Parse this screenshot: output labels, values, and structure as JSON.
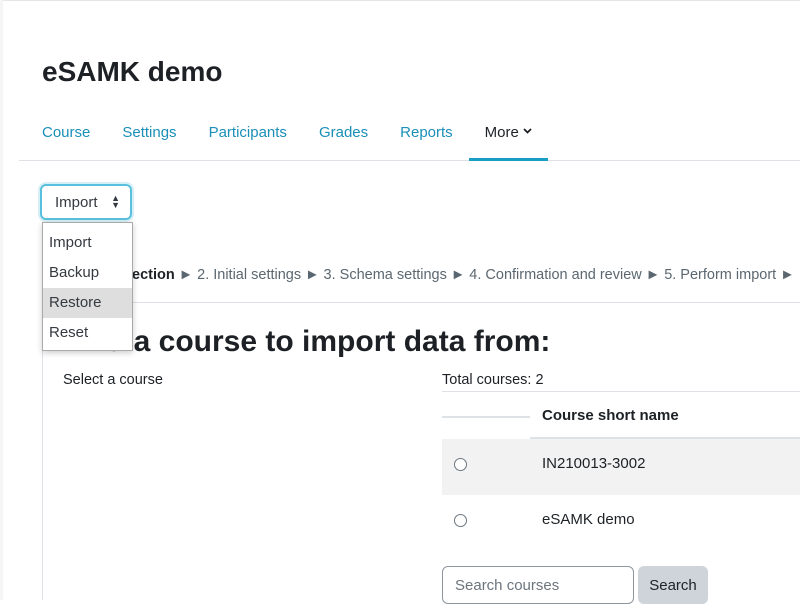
{
  "page": {
    "title": "eSAMK demo"
  },
  "nav": {
    "tabs": [
      {
        "label": "Course"
      },
      {
        "label": "Settings"
      },
      {
        "label": "Participants"
      },
      {
        "label": "Grades"
      },
      {
        "label": "Reports"
      },
      {
        "label": "More",
        "active": true,
        "icon": "chevron-down-icon"
      }
    ]
  },
  "action_select": {
    "value": "Import",
    "options": [
      "Import",
      "Backup",
      "Restore",
      "Reset"
    ],
    "highlighted": "Restore"
  },
  "steps": {
    "current": "1. Course selection",
    "visible_current": "ection",
    "separator": "►",
    "items": [
      "2. Initial settings",
      "3. Schema settings",
      "4. Confirmation and review",
      "5. Perform import"
    ]
  },
  "main": {
    "heading": "Find a course to import data from:",
    "heading_visible": "Find a course to import data from:",
    "select_course_label": "Select a course",
    "total_courses": "Total courses: 2"
  },
  "table": {
    "header_short_name": "Course short name",
    "rows": [
      {
        "short_name": "IN210013-3002"
      },
      {
        "short_name": "eSAMK demo"
      }
    ]
  },
  "search": {
    "placeholder": "Search courses",
    "button_label": "Search"
  },
  "colors": {
    "link": "#1a8fb8",
    "active_underline": "#1a9fc4",
    "focus_ring": "#5bc0de",
    "row_stripe": "#f2f2f2",
    "selected_option": "#dedede"
  }
}
